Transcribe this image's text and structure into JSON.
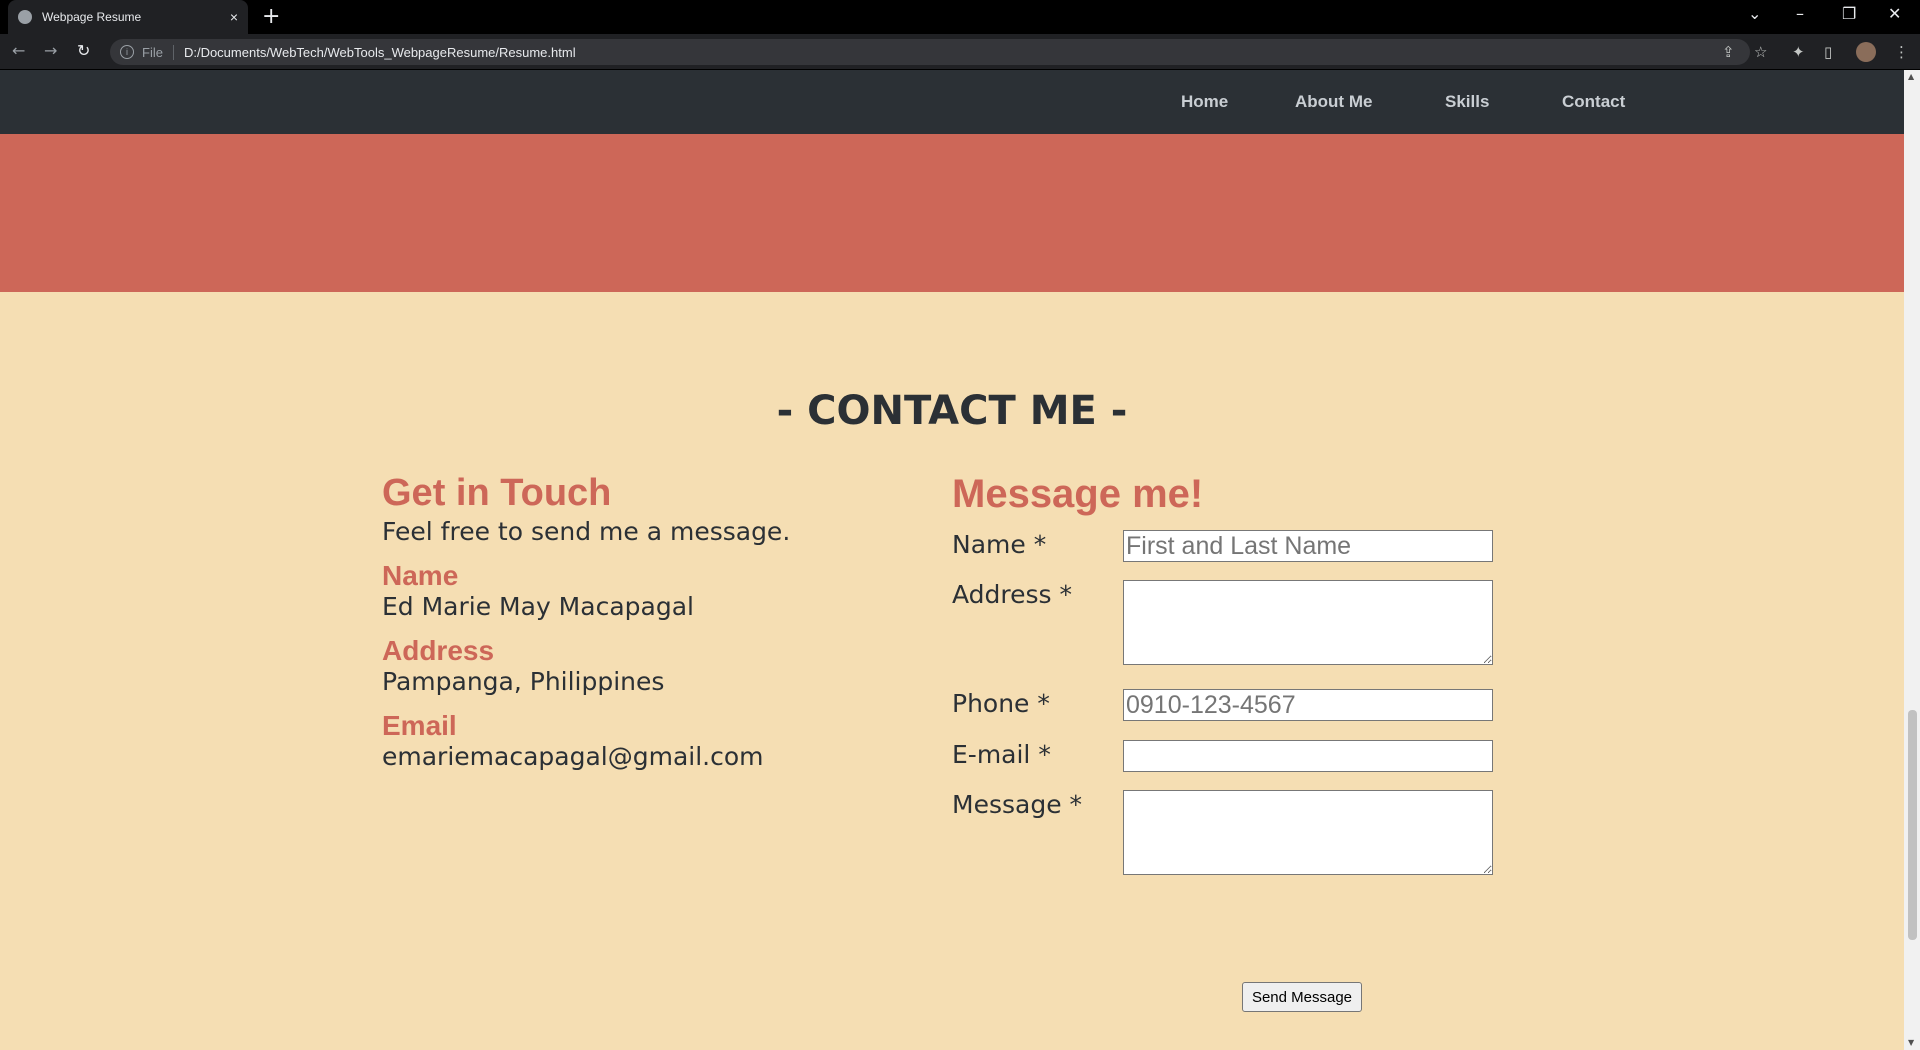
{
  "browser": {
    "tab_title": "Webpage Resume",
    "tab_close": "×",
    "new_tab": "+",
    "file_label": "File",
    "url": "D:/Documents/WebTech/WebTools_WebpageResume/Resume.html"
  },
  "nav": {
    "items": [
      {
        "label": "Home"
      },
      {
        "label": "About Me"
      },
      {
        "label": "Skills"
      },
      {
        "label": "Contact"
      }
    ]
  },
  "contact": {
    "heading": "- CONTACT ME -",
    "left": {
      "title": "Get in Touch",
      "subtitle": "Feel free to send me a message.",
      "name_label": "Name",
      "name_value": "Ed Marie May Macapagal",
      "address_label": "Address",
      "address_value": "Pampanga, Philippines",
      "email_label": "Email",
      "email_value": "emariemacapagal@gmail.com"
    },
    "form": {
      "title": "Message me!",
      "name_label": "Name *",
      "name_placeholder": "First and Last Name",
      "address_label": "Address *",
      "phone_label": "Phone *",
      "phone_placeholder": "0910-123-4567",
      "email_label": "E-mail *",
      "message_label": "Message *",
      "send_label": "Send Message"
    }
  },
  "colors": {
    "accent": "#cd6758",
    "background": "#f5deb3",
    "nav": "#2b3035"
  }
}
